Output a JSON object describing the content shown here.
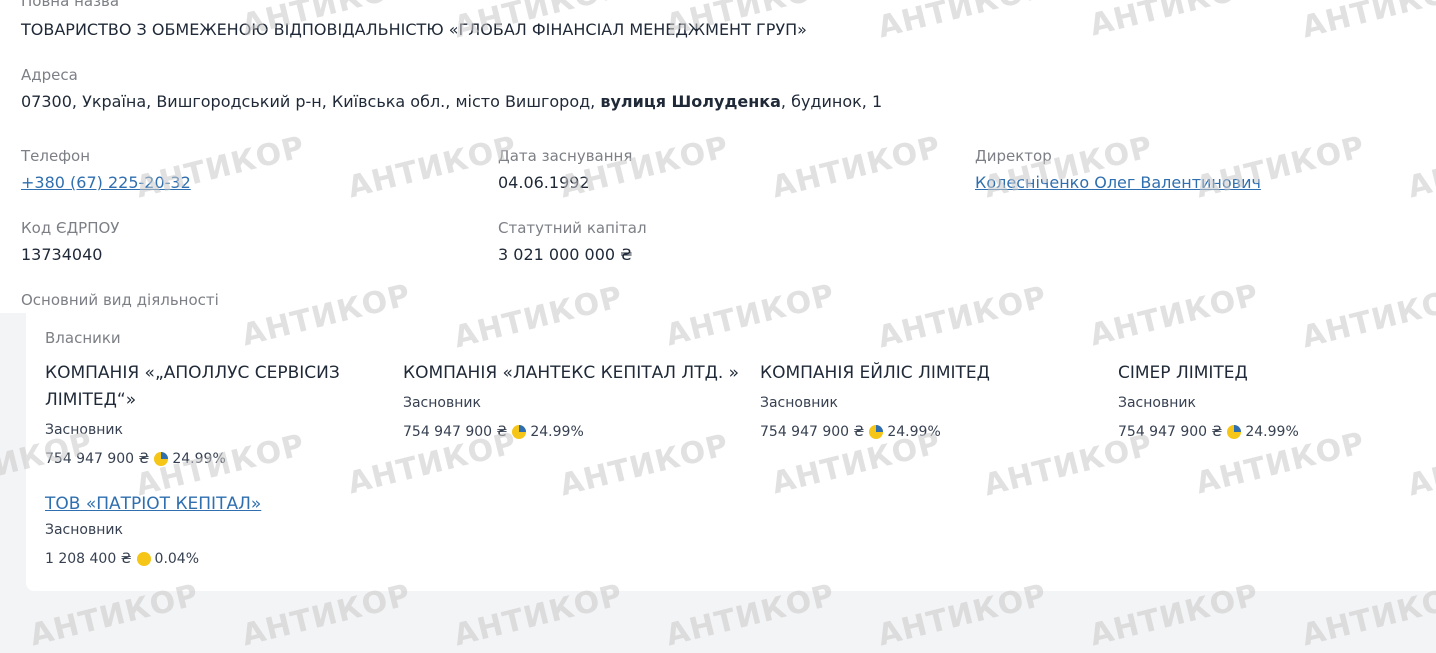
{
  "company": {
    "full_name_label": "Повна назва",
    "full_name": "ТОВАРИСТВО З ОБМЕЖЕНОЮ ВІДПОВІДАЛЬНІСТЮ «ГЛОБАЛ ФІНАНСІАЛ МЕНЕДЖМЕНТ ГРУП»",
    "address_label": "Адреса",
    "address_prefix": "07300, Україна, Вишгородський р-н, Київська обл., місто Вишгород,",
    "address_street": "вулиця Шолуденка",
    "address_suffix": ", будинок, 1",
    "phone_label": "Телефон",
    "phone": "+380 (67) 225-20-32",
    "founded_label": "Дата заснування",
    "founded": "04.06.1992",
    "director_label": "Директор",
    "director": "Колесніченко Олег Валентинович",
    "edrpou_label": "Код ЄДРПОУ",
    "edrpou": "13734040",
    "capital_label": "Статутний капітал",
    "capital": "3 021 000 000 ₴",
    "activity_label": "Основний вид діяльності"
  },
  "owners": {
    "label": "Власники",
    "items": [
      {
        "name": "КОМПАНІЯ «„АПОЛЛУС СЕРВІСИЗ ЛІМІТЕД“»",
        "role": "Засновник",
        "amount": "754 947 900 ₴",
        "share": "24.99%",
        "share_fraction": 0.2499,
        "link": false
      },
      {
        "name": "КОМПАНІЯ «ЛАНТЕКС КЕПІТАЛ ЛТД. »",
        "role": "Засновник",
        "amount": "754 947 900 ₴",
        "share": "24.99%",
        "share_fraction": 0.2499,
        "link": false
      },
      {
        "name": "КОМПАНІЯ ЕЙЛІС ЛІМІТЕД",
        "role": "Засновник",
        "amount": "754 947 900 ₴",
        "share": "24.99%",
        "share_fraction": 0.2499,
        "link": false
      },
      {
        "name": "СІМЕР ЛІМІТЕД",
        "role": "Засновник",
        "amount": "754 947 900 ₴",
        "share": "24.99%",
        "share_fraction": 0.2499,
        "link": false
      },
      {
        "name": "ТОВ «ПАТРІОТ КЕПІТАЛ»",
        "role": "Засновник",
        "amount": "1 208 400 ₴",
        "share": "0.04%",
        "share_fraction": 0.0004,
        "link": true
      }
    ]
  },
  "colors": {
    "pie_yellow": "#f5c518",
    "pie_blue": "#2f6fb0",
    "link": "#2f6fb0"
  },
  "watermark": "АНТИКОР"
}
